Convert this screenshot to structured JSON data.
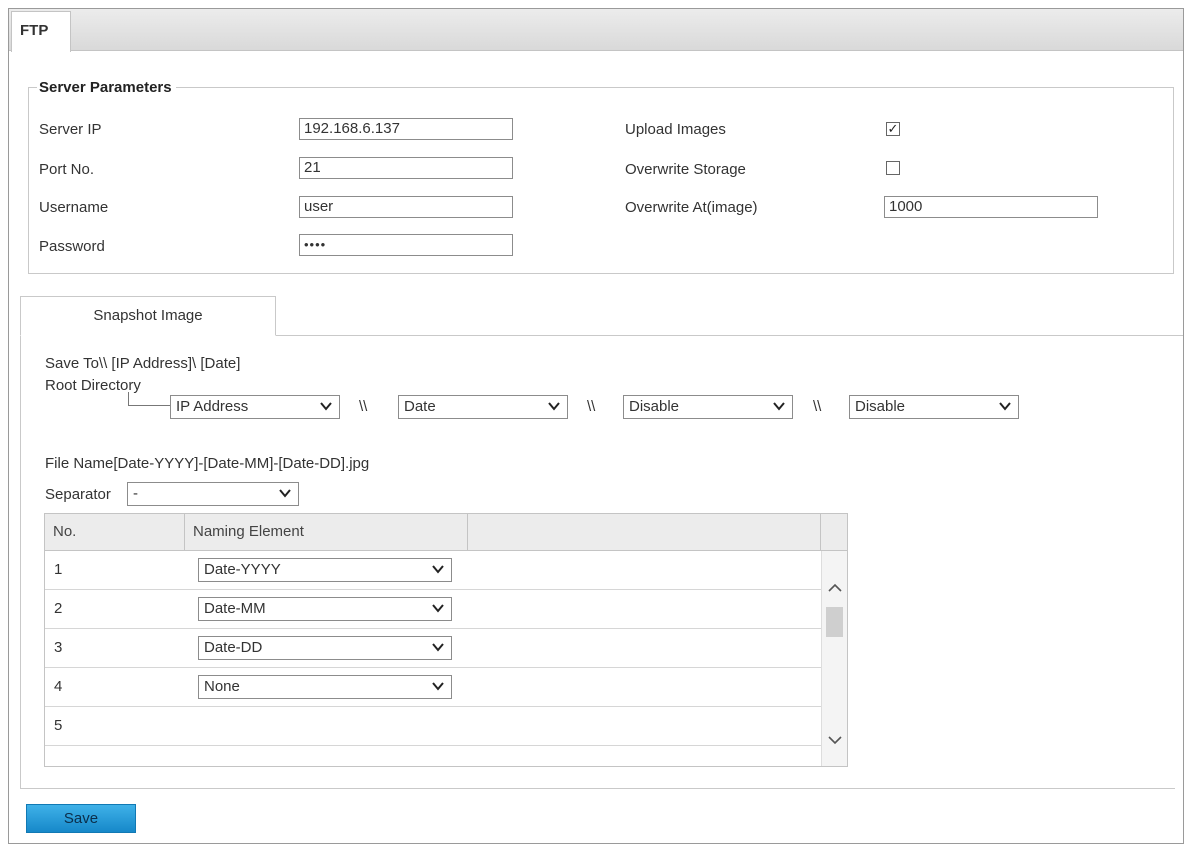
{
  "tabs": {
    "ftp": "FTP"
  },
  "server": {
    "title": "Server Parameters",
    "server_ip_label": "Server IP",
    "server_ip_value": "192.168.6.137",
    "port_label": "Port No.",
    "port_value": "21",
    "username_label": "Username",
    "username_value": "user",
    "password_label": "Password",
    "password_value": "••••",
    "upload_images_label": "Upload Images",
    "upload_images_checked": true,
    "upload_images_mark": "✓",
    "overwrite_storage_label": "Overwrite Storage",
    "overwrite_storage_checked": false,
    "overwrite_at_label": "Overwrite At(image)",
    "overwrite_at_value": "1000"
  },
  "snapshot": {
    "tab_label": "Snapshot Image",
    "save_to_text": "Save To\\\\ [IP Address]\\ [Date]",
    "root_directory_label": "Root Directory",
    "path_separator": "\\\\",
    "dir_selects": [
      "IP Address",
      "Date",
      "Disable",
      "Disable"
    ],
    "file_name_text": "File Name[Date-YYYY]-[Date-MM]-[Date-DD].jpg",
    "separator_label": "Separator",
    "separator_value": "-"
  },
  "table": {
    "headers": [
      "No.",
      "Naming Element"
    ],
    "rows": [
      {
        "no": "1",
        "element": "Date-YYYY"
      },
      {
        "no": "2",
        "element": "Date-MM"
      },
      {
        "no": "3",
        "element": "Date-DD"
      },
      {
        "no": "4",
        "element": "None"
      },
      {
        "no": "5",
        "element": ""
      }
    ]
  },
  "actions": {
    "save_label": "Save"
  },
  "colors": {
    "save_button": "#1e95d6",
    "tab_bar": "#dedede",
    "border": "#c9c9c9"
  },
  "icons": {
    "dropdown": "chevron-down-icon",
    "scroll_up": "chevron-up-icon",
    "scroll_down": "chevron-down-icon"
  }
}
